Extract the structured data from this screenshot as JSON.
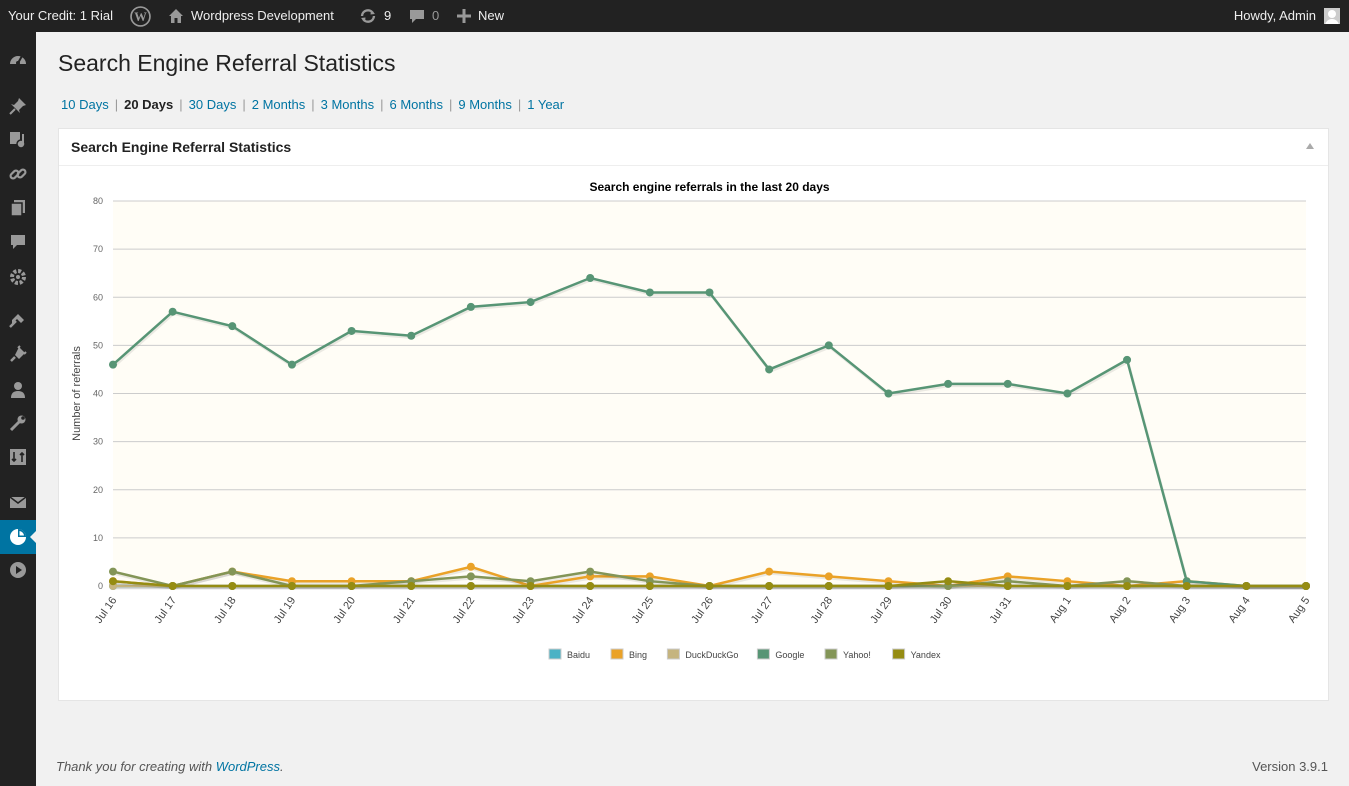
{
  "adminbar": {
    "credit": "Your Credit: 1 Rial",
    "site_name": "Wordpress Development",
    "updates_count": "9",
    "comments_count": "0",
    "new_label": "New",
    "howdy": "Howdy, Admin"
  },
  "sidebar": {
    "icons": [
      "dashboard-icon",
      "pin-icon",
      "media-icon",
      "links-icon",
      "pages-icon",
      "comments-icon",
      "settings-gear-icon",
      "appearance-icon",
      "plugins-icon",
      "users-icon",
      "tools-icon",
      "import-icon",
      "mail-icon",
      "statistics-icon",
      "play-icon"
    ],
    "current": "statistics-icon"
  },
  "page": {
    "title": "Search Engine Referral Statistics",
    "ranges": [
      "10 Days",
      "20 Days",
      "30 Days",
      "2 Months",
      "3 Months",
      "6 Months",
      "9 Months",
      "1 Year"
    ],
    "current_range": "20 Days"
  },
  "postbox": {
    "title": "Search Engine Referral Statistics"
  },
  "chart_data": {
    "type": "line",
    "title": "Search engine referrals in the last 20 days",
    "xlabel": "",
    "ylabel": "Number of referrals",
    "ylim": [
      0,
      80
    ],
    "yticks": [
      0,
      10,
      20,
      30,
      40,
      50,
      60,
      70,
      80
    ],
    "grid": true,
    "legend": "bottom-center",
    "categories": [
      "Jul 16",
      "Jul 17",
      "Jul 18",
      "Jul 19",
      "Jul 20",
      "Jul 21",
      "Jul 22",
      "Jul 23",
      "Jul 24",
      "Jul 25",
      "Jul 26",
      "Jul 27",
      "Jul 28",
      "Jul 29",
      "Jul 30",
      "Jul 31",
      "Aug 1",
      "Aug 2",
      "Aug 3",
      "Aug 4",
      "Aug 5"
    ],
    "series": [
      {
        "name": "Baidu",
        "color": "#4bb2c5",
        "values": [
          0,
          0,
          0,
          0,
          0,
          0,
          0,
          0,
          0,
          0,
          0,
          0,
          0,
          0,
          0,
          0,
          0,
          0,
          0,
          0,
          0
        ]
      },
      {
        "name": "Bing",
        "color": "#eaa228",
        "values": [
          1,
          0,
          3,
          1,
          1,
          1,
          4,
          0,
          2,
          2,
          0,
          3,
          2,
          1,
          0,
          2,
          1,
          0,
          1,
          0,
          0
        ]
      },
      {
        "name": "DuckDuckGo",
        "color": "#c5b47f",
        "values": [
          0,
          0,
          0,
          0,
          0,
          0,
          0,
          0,
          0,
          0,
          0,
          0,
          0,
          0,
          0,
          0,
          0,
          0,
          0,
          0,
          0
        ]
      },
      {
        "name": "Google",
        "color": "#579575",
        "values": [
          46,
          57,
          54,
          46,
          53,
          52,
          58,
          59,
          64,
          61,
          61,
          45,
          50,
          40,
          42,
          42,
          40,
          47,
          1,
          0,
          0
        ]
      },
      {
        "name": "Yahoo!",
        "color": "#839557",
        "values": [
          3,
          0,
          3,
          0,
          0,
          1,
          2,
          1,
          3,
          1,
          0,
          0,
          0,
          0,
          0,
          1,
          0,
          1,
          0,
          0,
          0
        ]
      },
      {
        "name": "Yandex",
        "color": "#958c12",
        "values": [
          1,
          0,
          0,
          0,
          0,
          0,
          0,
          0,
          0,
          0,
          0,
          0,
          0,
          0,
          1,
          0,
          0,
          0,
          0,
          0,
          0
        ]
      }
    ]
  },
  "footer": {
    "thanks_prefix": "Thank you for creating with ",
    "thanks_link": "WordPress",
    "thanks_suffix": ".",
    "version": "Version 3.9.1"
  }
}
